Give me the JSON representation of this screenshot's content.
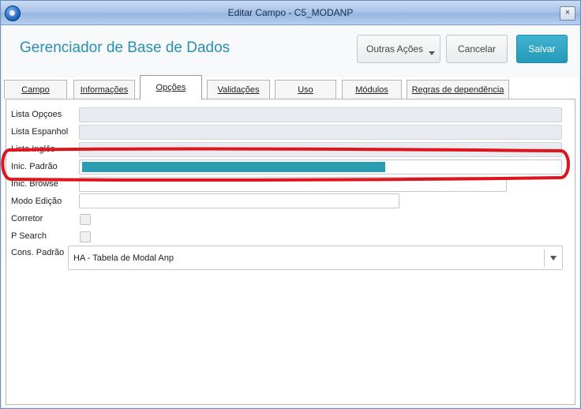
{
  "window": {
    "title": "Editar Campo - C5_MODANP",
    "close_label": "×"
  },
  "header": {
    "title": "Gerenciador de Base de Dados",
    "buttons": {
      "more_actions": "Outras Ações",
      "cancel": "Cancelar",
      "save": "Salvar"
    }
  },
  "tabs": [
    {
      "label": "Campo",
      "active": false
    },
    {
      "label": "Informações",
      "active": false
    },
    {
      "label": "Opções",
      "active": true
    },
    {
      "label": "Validações",
      "active": false
    },
    {
      "label": "Uso",
      "active": false
    },
    {
      "label": "Módulos",
      "active": false
    },
    {
      "label": "Regras de dependência",
      "active": false
    }
  ],
  "form": {
    "lista_opcoes": {
      "label": "Lista Opçoes",
      "value": ""
    },
    "lista_espanhol": {
      "label": "Lista Espanhol",
      "value": ""
    },
    "lista_ingles": {
      "label": "Lista Inglês",
      "value": ""
    },
    "inic_padrao": {
      "label": "Inic. Padrão",
      "value": ""
    },
    "inic_browse": {
      "label": "Inic. Browse",
      "value": ""
    },
    "modo_edicao": {
      "label": "Modo Edição",
      "value": ""
    },
    "corretor": {
      "label": "Corretor",
      "checked": false
    },
    "p_search": {
      "label": "P Search",
      "checked": false
    },
    "cons_padrao": {
      "label": "Cons. Padrão",
      "value": "HA - Tabela de Modal Anp"
    }
  },
  "colors": {
    "accent": "#2a8fb0",
    "save_button": "#2599b9",
    "highlight_annotation": "#e0141c",
    "selection": "#2b9db0"
  }
}
